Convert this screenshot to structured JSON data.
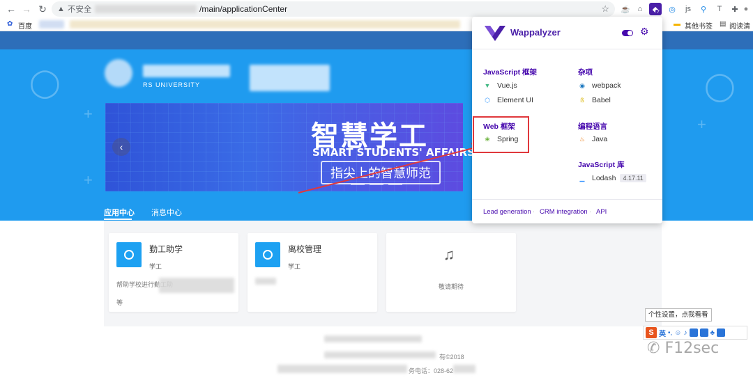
{
  "browser": {
    "back_icon": "arrow-left-icon",
    "forward_icon": "arrow-right-icon",
    "reload_icon": "reload-icon",
    "security_label": "不安全",
    "url_suffix": "/main/applicationCenter",
    "bookmarks": [
      "百度",
      "其他书签",
      "阅读清单"
    ]
  },
  "hero": {
    "university_en": "RS UNIVERSITY",
    "banner_title": "智慧学工",
    "banner_subtitle": "SMART STUDENTS' AFFAIRS",
    "banner_tag": "指尖上的智慧师范",
    "tabs": [
      "应用中心",
      "消息中心"
    ]
  },
  "cards": [
    {
      "title": "勤工助学",
      "category": "学工",
      "desc": "帮助学校进行勤工助",
      "desc2": "等"
    },
    {
      "title": "离校管理",
      "category": "学工"
    },
    {
      "soon": "敬请期待"
    }
  ],
  "footer": {
    "year": "有©2018",
    "phone": "务电话：028-62"
  },
  "wappalyzer": {
    "title": "Wappalyzer",
    "categories": [
      {
        "name": "JavaScript 框架",
        "techs": [
          {
            "name": "Vue.js",
            "icon": "vue-icon"
          },
          {
            "name": "Element UI",
            "icon": "element-ui-icon"
          }
        ]
      },
      {
        "name": "杂项",
        "techs": [
          {
            "name": "webpack",
            "icon": "webpack-icon"
          },
          {
            "name": "Babel",
            "icon": "babel-icon"
          }
        ]
      },
      {
        "name": "Web 框架",
        "techs": [
          {
            "name": "Spring",
            "icon": "spring-icon"
          }
        ]
      },
      {
        "name": "编程语言",
        "techs": [
          {
            "name": "Java",
            "icon": "java-icon"
          }
        ]
      },
      {
        "name": "JavaScript 库",
        "techs": [
          {
            "name": "Lodash",
            "version": "4.17.11",
            "icon": "lodash-icon"
          }
        ]
      }
    ],
    "footer_links": [
      "Lead generation",
      "CRM integration",
      "API"
    ],
    "badge_count": "7"
  },
  "ime": {
    "tip": "个性设置，点我看看",
    "mode": "英"
  },
  "watermark": "F12sec",
  "colors": {
    "accent": "#4608ad",
    "hero_blue": "#1f9bef",
    "highlight": "#e0383c"
  }
}
